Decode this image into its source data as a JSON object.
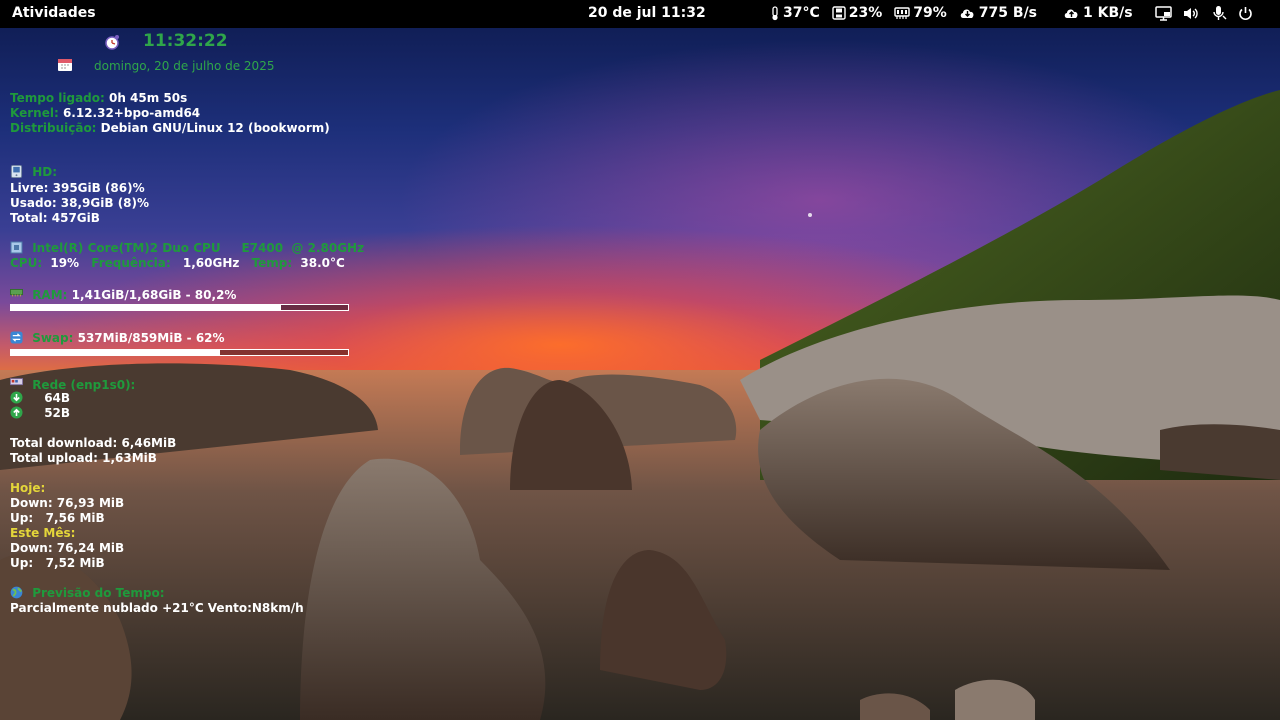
{
  "topbar": {
    "activities": "Atividades",
    "clock": "20 de jul  11:32",
    "indicators": [
      {
        "icon": "thermometer-icon",
        "value": "37°C"
      },
      {
        "icon": "disk-icon",
        "value": "23%"
      },
      {
        "icon": "memory-icon",
        "value": "79%"
      },
      {
        "icon": "download-cloud-icon",
        "value": "775 B/s"
      },
      {
        "icon": "upload-cloud-icon",
        "value": "1 KB/s"
      }
    ]
  },
  "conky": {
    "time": "11:32:22",
    "date": "domingo, 20 de julho de 2025",
    "uptime_label": "Tempo ligado:",
    "uptime_value": "0h 45m 50s",
    "kernel_label": "Kernel:",
    "kernel_value": "6.12.32+bpo-amd64",
    "distro_label": "Distribuição:",
    "distro_value": "Debian GNU/Linux 12 (bookworm)",
    "hd_title": "HD:",
    "hd_free": "Livre: 395GiB (86)%",
    "hd_used": "Usado: 38,9GiB (8)%",
    "hd_total": "Total: 457GiB",
    "cpu_model": "Intel(R) Core(TM)2 Duo CPU     E7400  @ 2.80GHz",
    "cpu_label": "CPU:",
    "cpu_value": "19%",
    "freq_label": "Frequência:",
    "freq_value": "1,60GHz",
    "temp_label": "Temp:",
    "temp_value": "38.0°C",
    "ram_label": "RAM:",
    "ram_value": "1,41GiB/1,68GiB - 80,2%",
    "ram_fraction": 0.802,
    "swap_label": "Swap:",
    "swap_value": "537MiB/859MiB - 62%",
    "swap_fraction": 0.62,
    "net_title": "Rede (enp1s0):",
    "net_down": "64B",
    "net_up": "52B",
    "total_download": "Total download: 6,46MiB",
    "total_upload": "Total upload: 1,63MiB",
    "today_label": "Hoje:",
    "today_down": "Down: 76,93 MiB",
    "today_up": "Up:   7,56 MiB",
    "month_label": "Este Mês:",
    "month_down": "Down: 76,24 MiB",
    "month_up": "Up:   7,52 MiB",
    "weather_title": "Previsão do Tempo:",
    "weather_value": "Parcialmente nublado +21°C Vento:N8km/h"
  },
  "colors": {
    "label_green": "#1f9a3c",
    "label_yellow": "#e4d63a",
    "topbar_bg": "#000000"
  }
}
